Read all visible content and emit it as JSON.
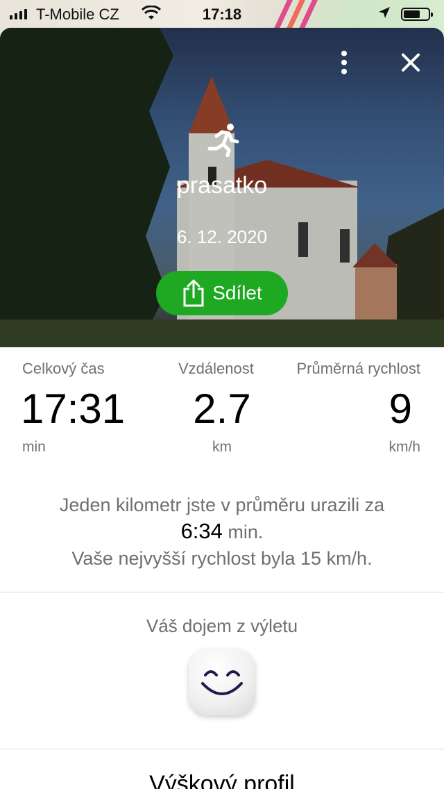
{
  "status_bar": {
    "carrier": "T-Mobile CZ",
    "time": "17:18"
  },
  "header": {
    "activity_icon": "running-icon",
    "title": "prasatko",
    "date": "6. 12. 2020",
    "share_label": "Sdílet",
    "share_color": "#1fa822"
  },
  "stats": {
    "total_time": {
      "label": "Celkový čas",
      "value": "17:31",
      "unit": "min"
    },
    "distance": {
      "label": "Vzdálenost",
      "value": "2.7",
      "unit": "km"
    },
    "avg_speed": {
      "label": "Průměrná rychlost",
      "value": "9",
      "unit": "km/h"
    }
  },
  "summary": {
    "line1": "Jeden kilometr jste v průměru urazili za",
    "pace_value": "6:34",
    "pace_unit": "min.",
    "line3": "Vaše nejvyšší rychlost byla 15 km/h."
  },
  "impression": {
    "title": "Váš dojem z výletu",
    "icon": "smiley-face-icon"
  },
  "elevation_profile": {
    "title": "Výškový profil"
  }
}
